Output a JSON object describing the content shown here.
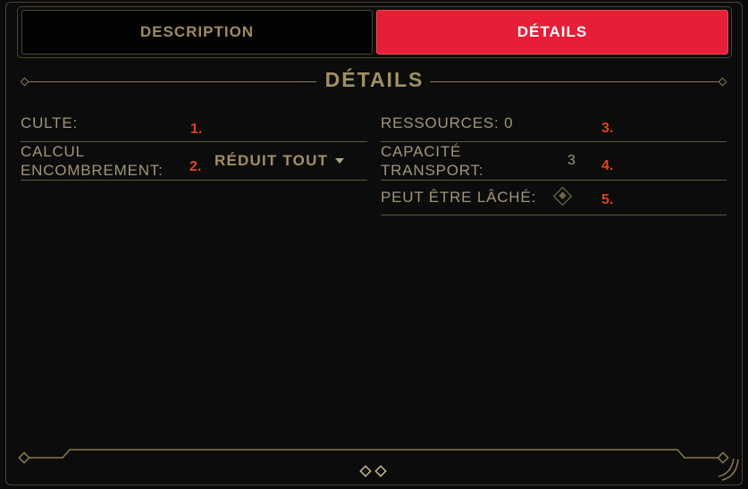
{
  "tabs": [
    {
      "label": "DESCRIPTION",
      "active": false
    },
    {
      "label": "DÉTAILS",
      "active": true
    }
  ],
  "section": {
    "title": "DÉTAILS"
  },
  "fields": {
    "culte": {
      "label": "CULTE:",
      "num": "1."
    },
    "calcul": {
      "label_line1": "CALCUL",
      "label_line2": "ENCOMBREMENT:",
      "num": "2.",
      "value": "RÉDUIT TOUT"
    },
    "ressources": {
      "label": "RESSOURCES: 0",
      "num": "3."
    },
    "capacite": {
      "label_line1": "CAPACITÉ",
      "label_line2": "TRANSPORT:",
      "value": "3",
      "num": "4."
    },
    "lache": {
      "label": "PEUT ÊTRE LÂCHÉ:",
      "num": "5."
    }
  },
  "colors": {
    "active_tab": "#e61e37",
    "gold": "#a18f64",
    "marker": "#e2421c"
  }
}
